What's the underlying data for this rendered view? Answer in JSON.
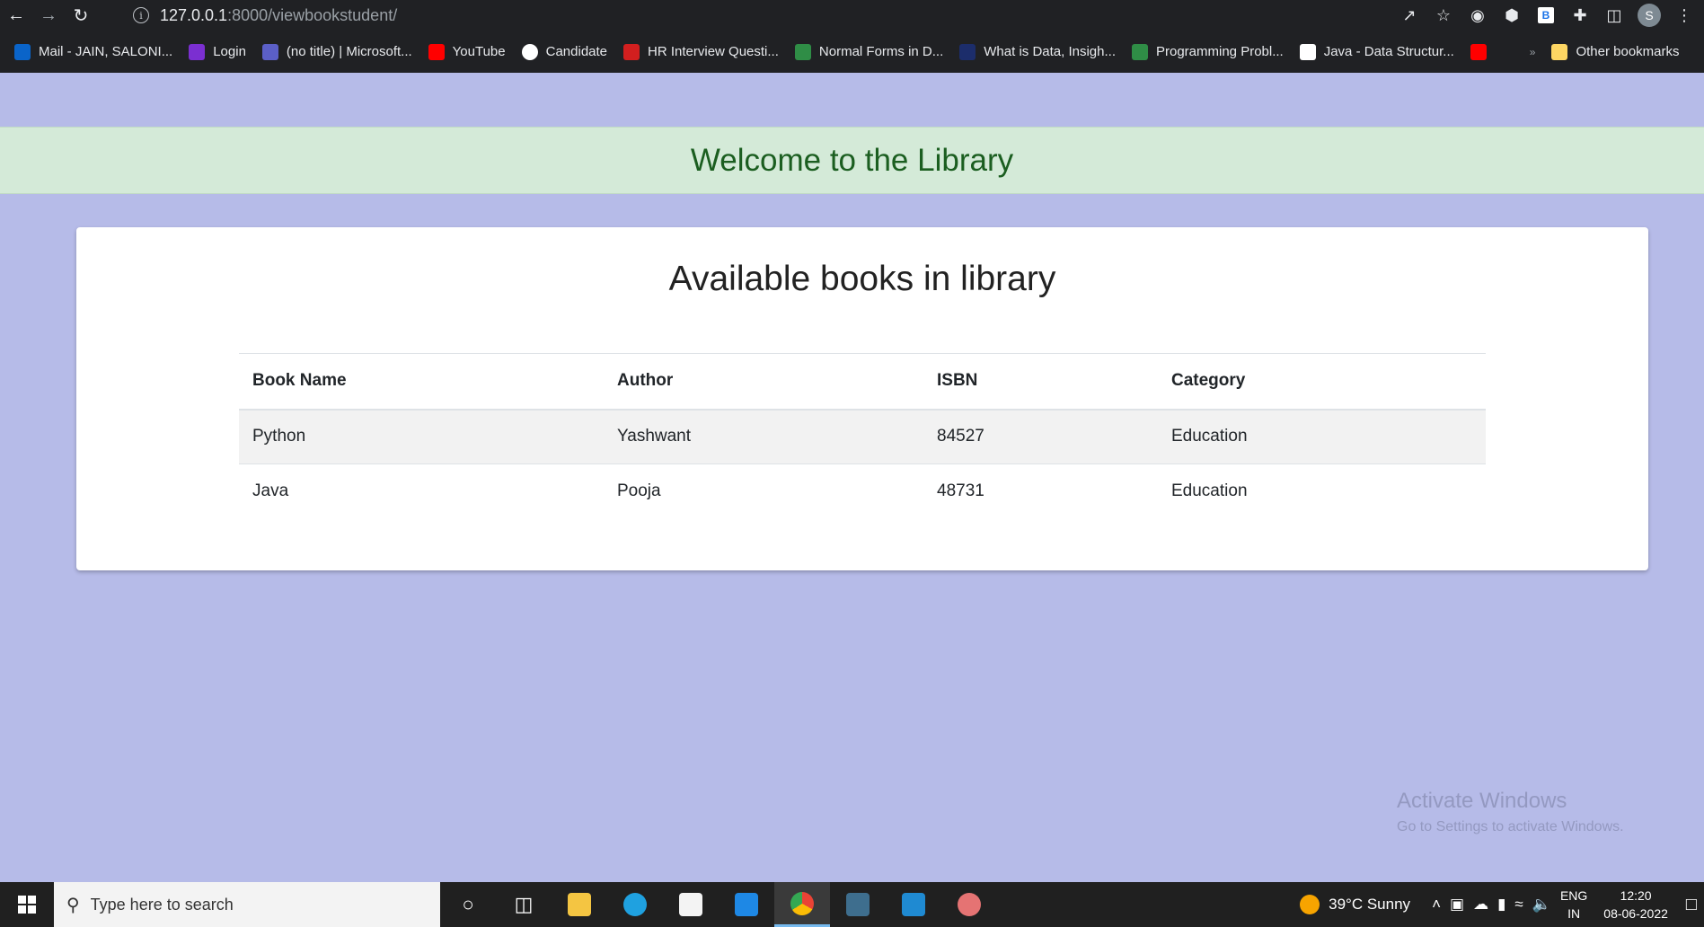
{
  "browser": {
    "url_host": "127.0.0.1",
    "url_path": ":8000/viewbookstudent/",
    "avatar_letter": "S",
    "bookmarks": [
      {
        "label": "Mail - JAIN, SALONI...",
        "color": "#0a64c9"
      },
      {
        "label": "Login",
        "color": "#7b2fd1"
      },
      {
        "label": "(no title) | Microsoft...",
        "color": "#5b5fc7"
      },
      {
        "label": "YouTube",
        "color": "#ff0000"
      },
      {
        "label": "Candidate",
        "color": "#ffffff"
      },
      {
        "label": "HR Interview Questi...",
        "color": "#d21f1f"
      },
      {
        "label": "Normal Forms in D...",
        "color": "#2f8d46"
      },
      {
        "label": "What is Data, Insigh...",
        "color": "#1c2d6b"
      },
      {
        "label": "Programming Probl...",
        "color": "#2f8d46"
      },
      {
        "label": "Java - Data Structur...",
        "color": "#ffffff"
      }
    ],
    "other_bookmarks": "Other bookmarks"
  },
  "page": {
    "banner_title": "Welcome to the Library",
    "card_title": "Available books in library",
    "columns": [
      "Book Name",
      "Author",
      "ISBN",
      "Category"
    ],
    "rows": [
      [
        "Python",
        "Yashwant",
        "84527",
        "Education"
      ],
      [
        "Java",
        "Pooja",
        "48731",
        "Education"
      ]
    ]
  },
  "watermark": {
    "line1": "Activate Windows",
    "line2": "Go to Settings to activate Windows."
  },
  "taskbar": {
    "search_placeholder": "Type here to search",
    "weather": "39°C  Sunny",
    "lang_line1": "ENG",
    "lang_line2": "IN",
    "time": "12:20",
    "date": "08-06-2022"
  }
}
